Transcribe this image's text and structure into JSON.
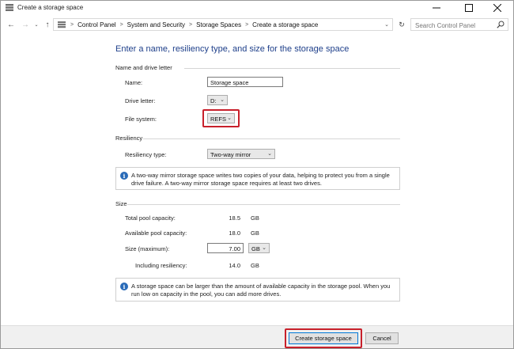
{
  "window": {
    "title": "Create a storage space",
    "controls": {
      "minimize": "minimize-icon",
      "maximize": "maximize-icon",
      "close": "close-icon"
    }
  },
  "nav": {
    "breadcrumb": [
      "Control Panel",
      "System and Security",
      "Storage Spaces",
      "Create a storage space"
    ],
    "search_placeholder": "Search Control Panel"
  },
  "page": {
    "heading": "Enter a name, resiliency type, and size for the storage space"
  },
  "name_section": {
    "title": "Name and drive letter",
    "name_label": "Name:",
    "name_value": "Storage space",
    "drive_letter_label": "Drive letter:",
    "drive_letter_value": "D:",
    "file_system_label": "File system:",
    "file_system_value": "REFS"
  },
  "resiliency_section": {
    "title": "Resiliency",
    "type_label": "Resiliency type:",
    "type_value": "Two-way mirror",
    "info": "A two-way mirror storage space writes two copies of your data, helping to protect you from a single drive failure. A two-way mirror storage space requires at least two drives."
  },
  "size_section": {
    "title": "Size",
    "total_label": "Total pool capacity:",
    "total_value": "18.5",
    "total_unit": "GB",
    "available_label": "Available pool capacity:",
    "available_value": "18.0",
    "available_unit": "GB",
    "max_label": "Size (maximum):",
    "max_value": "7.00",
    "max_unit": "GB",
    "including_label": "Including resiliency:",
    "including_value": "14.0",
    "including_unit": "GB",
    "info": "A storage space can be larger than the amount of available capacity in the storage pool. When you run low on capacity in the pool, you can add more drives."
  },
  "buttons": {
    "create": "Create storage space",
    "cancel": "Cancel"
  },
  "colors": {
    "heading": "#1e3f8a",
    "highlight": "#c8202b",
    "info_icon": "#2a6bb8"
  }
}
